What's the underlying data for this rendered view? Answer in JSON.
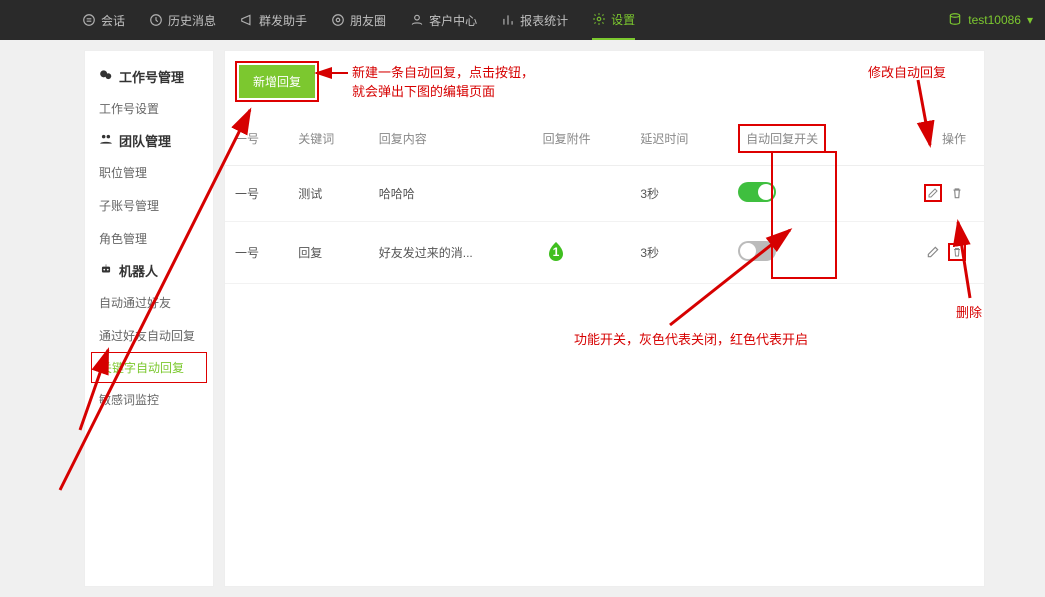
{
  "topnav": {
    "items": [
      {
        "label": "会话",
        "icon": "chat-icon"
      },
      {
        "label": "历史消息",
        "icon": "history-icon"
      },
      {
        "label": "群发助手",
        "icon": "broadcast-icon"
      },
      {
        "label": "朋友圈",
        "icon": "moments-icon"
      },
      {
        "label": "客户中心",
        "icon": "customer-icon"
      },
      {
        "label": "报表统计",
        "icon": "stats-icon"
      },
      {
        "label": "设置",
        "icon": "settings-icon",
        "active": true
      }
    ],
    "user": "test10086"
  },
  "sidebar": {
    "groups": [
      {
        "title": "工作号管理",
        "icon": "wechat-icon",
        "items": [
          "工作号设置"
        ]
      },
      {
        "title": "团队管理",
        "icon": "team-icon",
        "items": [
          "职位管理",
          "子账号管理",
          "角色管理"
        ]
      },
      {
        "title": "机器人",
        "icon": "robot-icon",
        "items": [
          "自动通过好友",
          "通过好友自动回复",
          "关键字自动回复",
          "敏感词监控"
        ],
        "activeIndex": 2
      }
    ]
  },
  "content": {
    "add_button": "新增回复",
    "table": {
      "headers": [
        "一号",
        "关键词",
        "回复内容",
        "回复附件",
        "延迟时间",
        "自动回复开关",
        "操作"
      ],
      "rows": [
        {
          "col0": "一号",
          "keyword": "测试",
          "text": "哈哈哈",
          "attach": "",
          "delay": "3秒",
          "switch": "on"
        },
        {
          "col0": "一号",
          "keyword": "回复",
          "text": "好友发过来的消...",
          "attach": "img",
          "delay": "3秒",
          "switch": "off"
        }
      ]
    }
  },
  "annotations": {
    "new_reply": "新建一条自动回复，点击按钮，\n就会弹出下图的编辑页面",
    "edit": "修改自动回复",
    "delete": "删除",
    "switch_note": "功能开关，灰色代表关闭，红色代表开启"
  }
}
